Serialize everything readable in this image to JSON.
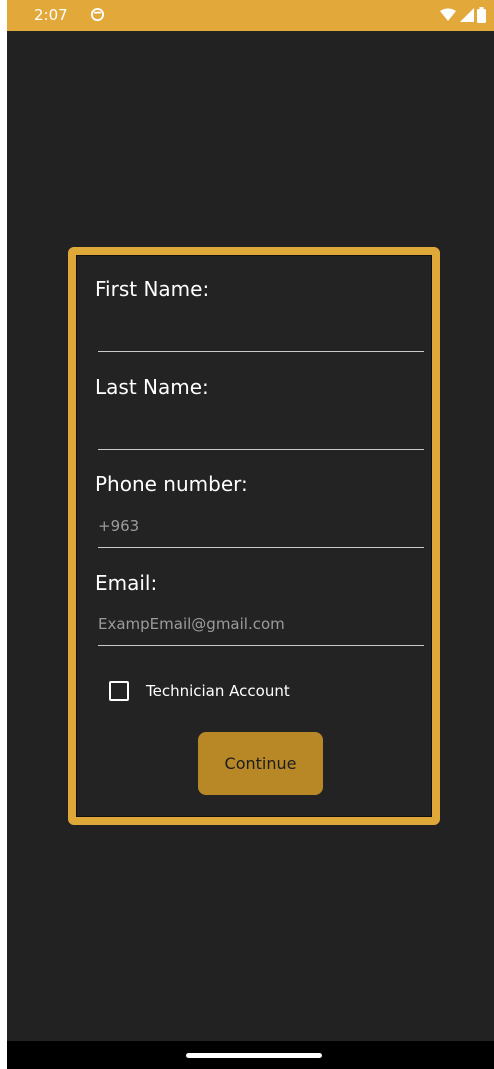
{
  "status_bar": {
    "time": "2:07",
    "background_color": "#e2a83a",
    "sync_icon": "sync-icon",
    "wifi_icon": "wifi-icon",
    "signal_icon": "signal-icon",
    "battery_icon": "battery-icon"
  },
  "form": {
    "border_color": "#e0a838",
    "first_name": {
      "label": "First Name:",
      "value": "",
      "placeholder": ""
    },
    "last_name": {
      "label": "Last Name:",
      "value": "",
      "placeholder": ""
    },
    "phone": {
      "label": "Phone number:",
      "value": "",
      "placeholder": "+963"
    },
    "email": {
      "label": "Email:",
      "value": "",
      "placeholder": "ExampEmail@gmail.com"
    },
    "technician_checkbox": {
      "label": "Technician Account",
      "checked": false
    },
    "continue_button": {
      "label": "Continue",
      "color": "#b78825"
    }
  }
}
